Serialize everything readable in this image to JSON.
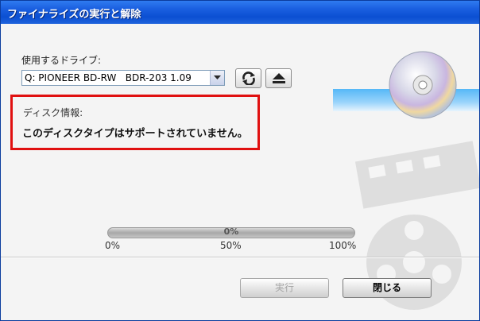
{
  "window": {
    "title": "ファイナライズの実行と解除"
  },
  "drive": {
    "label": "使用するドライブ:",
    "selected": "Q: PIONEER BD-RW   BDR-203 1.09"
  },
  "toolbar": {
    "refresh_icon": "refresh-icon",
    "eject_icon": "eject-icon"
  },
  "disc_info": {
    "label": "ディスク情報:",
    "message": "このディスクタイプはサポートされていません。"
  },
  "progress": {
    "value_percent": 0,
    "label": "0%",
    "ticks": [
      "0%",
      "50%",
      "100%"
    ]
  },
  "buttons": {
    "execute": "実行",
    "close": "閉じる"
  },
  "colors": {
    "titlebar": "#0b4fd2",
    "highlight_frame": "#e01010"
  }
}
